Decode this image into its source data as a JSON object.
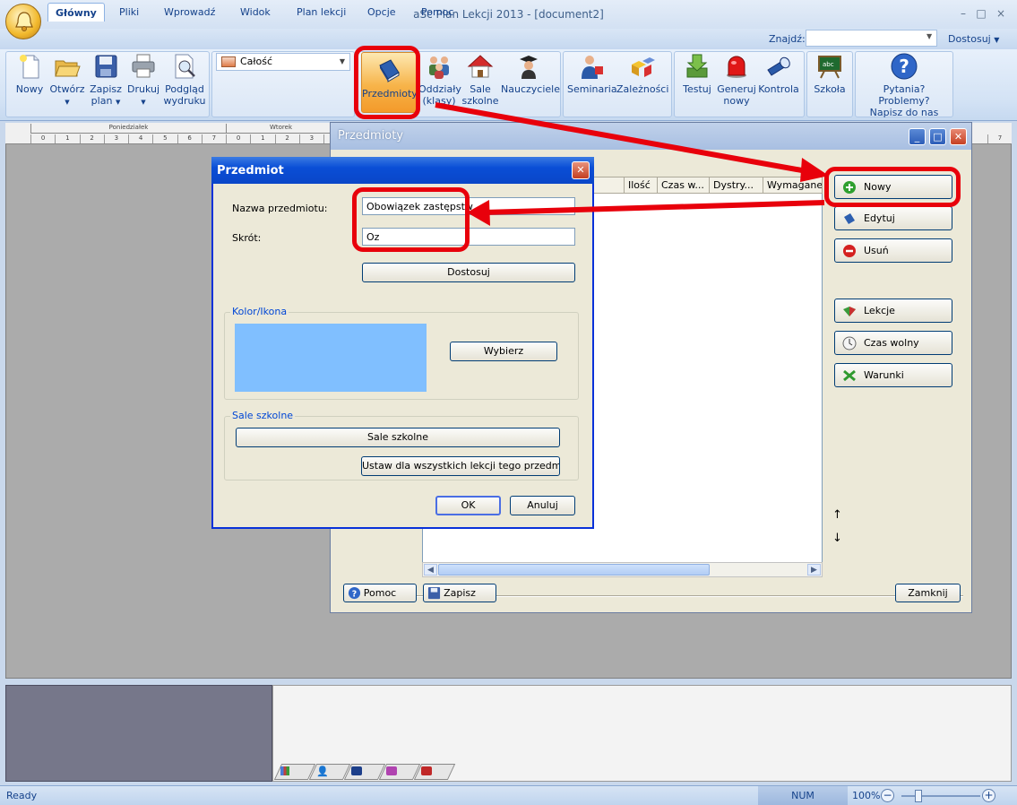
{
  "window": {
    "title": "aSc Plan Lekcji 2013  - [document2]",
    "controls": [
      "–",
      "□",
      "×"
    ]
  },
  "ribbon": {
    "tabs": [
      {
        "label": "Główny",
        "active": true
      },
      {
        "label": "Pliki"
      },
      {
        "label": "Wprowadź"
      },
      {
        "label": "Widok"
      },
      {
        "label": "Plan lekcji"
      },
      {
        "label": "Opcje"
      },
      {
        "label": "Pomoc"
      }
    ],
    "find_label": "Znajdź:",
    "find_value": "",
    "customize": "Dostosuj",
    "view_select": "Całość",
    "buttons": {
      "new": "Nowy",
      "open": "Otwórz",
      "save_line1": "Zapisz",
      "save_line2": "plan",
      "print": "Drukuj",
      "preview_line1": "Podgląd",
      "preview_line2": "wydruku",
      "subjects": "Przedmioty",
      "classes_line1": "Oddziały",
      "classes_line2": "(klasy)",
      "rooms_line1": "Sale",
      "rooms_line2": "szkolne",
      "teachers": "Nauczyciele",
      "seminars": "Seminaria",
      "dependencies": "Zależności",
      "test": "Testuj",
      "generate_line1": "Generuj",
      "generate_line2": "nowy",
      "control": "Kontrola",
      "school": "Szkoła",
      "help_line1": "Pytania? Problemy?",
      "help_line2": "Napisz do nas"
    }
  },
  "ruler": {
    "days": [
      "Poniedziałek",
      "Wtorek"
    ],
    "periods": [
      "0",
      "1",
      "2",
      "3",
      "4",
      "5",
      "6",
      "7"
    ],
    "tail_period": "7"
  },
  "subjects_window": {
    "title": "Przedmioty",
    "columns": [
      "Ilość",
      "Czas w...",
      "Dystry...",
      "Wymagane"
    ],
    "buttons": {
      "new": "Nowy",
      "edit": "Edytuj",
      "delete": "Usuń",
      "lessons": "Lekcje",
      "free_time": "Czas wolny",
      "conditions": "Warunki",
      "help": "Pomoc",
      "save": "Zapisz",
      "close": "Zamknij"
    }
  },
  "subject_dialog": {
    "title": "Przedmiot",
    "name_label": "Nazwa przedmiotu:",
    "name_value": "Obowiązek zastępstw",
    "short_label": "Skrót:",
    "short_value": "Oz",
    "customize_button": "Dostosuj",
    "color_group": "Kolor/Ikona",
    "color_value": "#80bfff",
    "choose_button": "Wybierz",
    "rooms_group": "Sale szkolne",
    "rooms_button": "Sale szkolne",
    "set_all_button": "Ustaw dla wszystkich lekcji tego przedmiotu",
    "ok": "OK",
    "cancel": "Anuluj"
  },
  "status": {
    "ready": "Ready",
    "num": "NUM",
    "zoom": "100%"
  },
  "annotation_color": "#e8000b"
}
